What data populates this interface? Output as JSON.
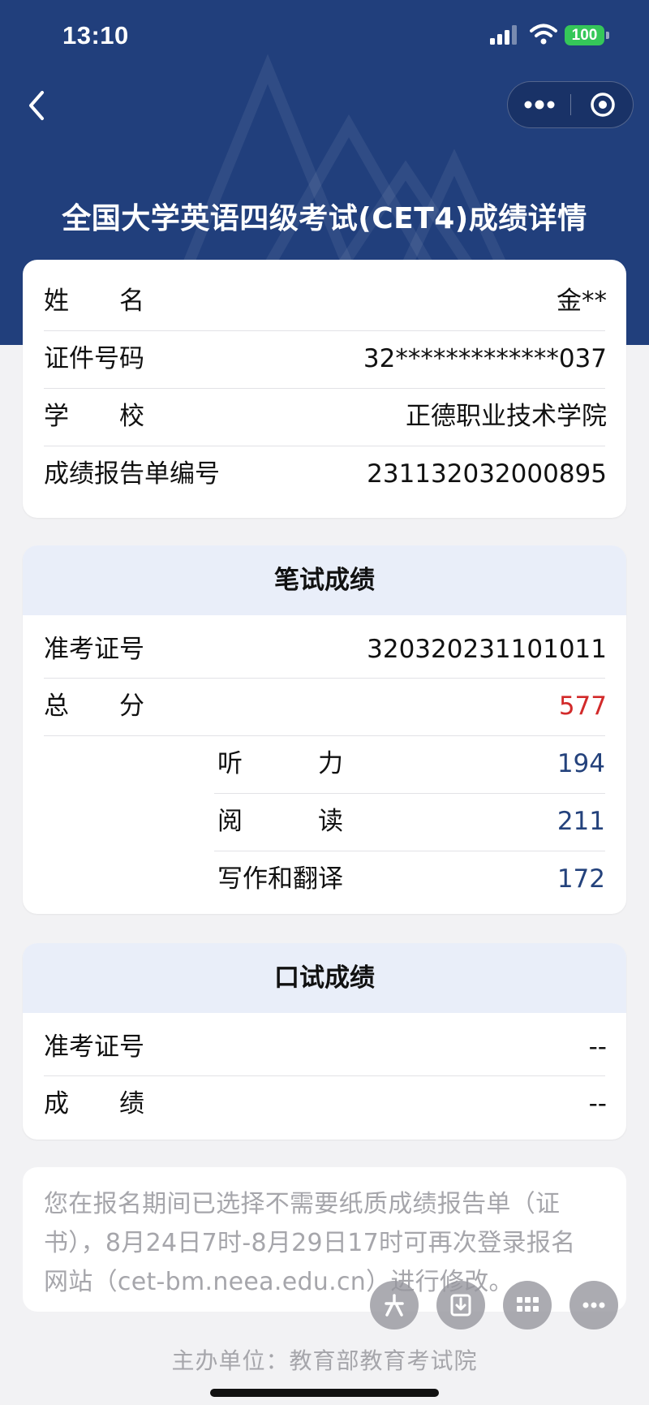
{
  "status_bar": {
    "time": "13:10",
    "battery": "100"
  },
  "page": {
    "title": "全国大学英语四级考试(CET4)成绩详情"
  },
  "info": {
    "rows": [
      {
        "label": "姓　　名",
        "value": "金**"
      },
      {
        "label": "证件号码",
        "value": "32*************037"
      },
      {
        "label": "学　　校",
        "value": "正德职业技术学院"
      },
      {
        "label": "成绩报告单编号",
        "value": "231132032000895"
      }
    ]
  },
  "written": {
    "title": "笔试成绩",
    "ticket": {
      "label": "准考证号",
      "value": "320320231101011"
    },
    "total": {
      "label": "总　　分",
      "value": "577"
    },
    "sections": [
      {
        "label": "听　　　力",
        "value": "194"
      },
      {
        "label": "阅　　　读",
        "value": "211"
      },
      {
        "label": "写作和翻译",
        "value": "172"
      }
    ]
  },
  "oral": {
    "title": "口试成绩",
    "ticket": {
      "label": "准考证号",
      "value": "--"
    },
    "score": {
      "label": "成　　绩",
      "value": "--"
    }
  },
  "notice": {
    "lines": [
      "您在报名期间已选择不需要纸质成绩报告单（证",
      "书），8月24日7时-8月29日17时可再次登录报名",
      "网站（cet-bm.neea.edu.cn）进行修改。"
    ]
  },
  "footer": {
    "text": "主办单位：教育部教育考试院"
  },
  "colors": {
    "header_bg": "#213f7c",
    "total_score": "#d22a2a",
    "section_score": "#24427c",
    "section_head_bg": "#e9eef9"
  },
  "icons": {
    "back": "chevron-left-icon",
    "more": "more-dots-icon",
    "close": "target-circle-icon",
    "fab": [
      "sparkle-icon",
      "download-icon",
      "grid-icon",
      "more-dots-icon"
    ]
  }
}
